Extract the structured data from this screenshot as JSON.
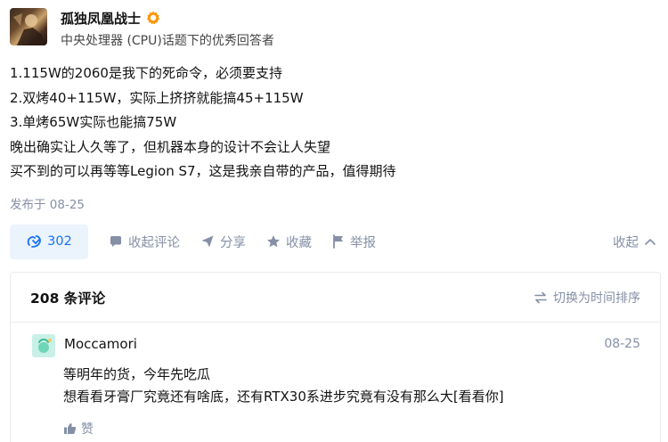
{
  "author": {
    "name": "孤独凤凰战士",
    "headline": "中央处理器 (CPU)话题下的优秀回答者"
  },
  "answer": {
    "lines": [
      "1.115W的2060是我下的死命令，必须要支持",
      "2.双烤40+115W，实际上挤挤就能搞45+115W",
      "3.单烤65W实际也能搞75W",
      "晚出确实让人久等了，但机器本身的设计不会让人失望",
      "买不到的可以再等等Legion S7，这是我亲自带的产品，值得期待"
    ],
    "published": "发布于 08-25"
  },
  "actions": {
    "vote_count": "302",
    "collapse_comments": "收起评论",
    "share": "分享",
    "favorite": "收藏",
    "report": "举报",
    "collapse": "收起"
  },
  "comments": {
    "count_label": "208 条评论",
    "sort_label": "切换为时间排序",
    "items": [
      {
        "user": "Moccamori",
        "date": "08-25",
        "line1": "等明年的货，今年先吃瓜",
        "line2": "想看看牙膏厂究竟还有啥底，还有RTX30系进步究竟有没有那么大[看看你]",
        "like_label": "赞"
      }
    ]
  },
  "colors": {
    "accent": "#1772f6",
    "vote_bg": "#ebf3fc",
    "muted": "#8590a6",
    "badge": "#ff9607"
  },
  "icons": [
    "badge-icon",
    "vote-up-icon",
    "comment-icon",
    "share-icon",
    "star-icon",
    "flag-icon",
    "chevron-up-icon",
    "swap-icon",
    "thumb-up-icon"
  ]
}
